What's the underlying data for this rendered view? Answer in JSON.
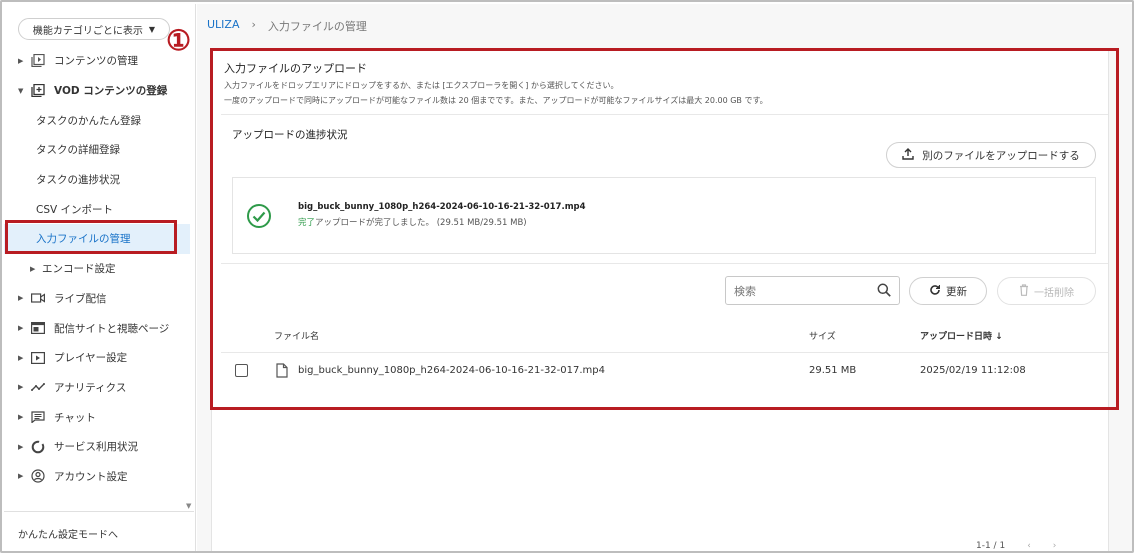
{
  "sidebar": {
    "category_select": "機能カテゴリごとに表示",
    "items": [
      {
        "label": "コンテンツの管理"
      },
      {
        "label": "VOD コンテンツの登録"
      },
      {
        "label": "タスクのかんたん登録"
      },
      {
        "label": "タスクの詳細登録"
      },
      {
        "label": "タスクの進捗状況"
      },
      {
        "label": "CSV インポート"
      },
      {
        "label": "入力ファイルの管理"
      },
      {
        "label": "エンコード設定"
      },
      {
        "label": "ライブ配信"
      },
      {
        "label": "配信サイトと視聴ページ"
      },
      {
        "label": "プレイヤー設定"
      },
      {
        "label": "アナリティクス"
      },
      {
        "label": "チャット"
      },
      {
        "label": "サービス利用状況"
      },
      {
        "label": "アカウント設定"
      }
    ],
    "simple_mode": "かんたん設定モードへ"
  },
  "breadcrumb": {
    "root": "ULIZA",
    "sep": "›",
    "current": "入力ファイルの管理"
  },
  "annotation_number": "①",
  "upload": {
    "title": "入力ファイルのアップロード",
    "desc1": "入力ファイルをドロップエリアにドロップをするか、または [エクスプローラを開く] から選択してください。",
    "desc2": "一度のアップロードで同時にアップロードが可能なファイル数は 20 個までです。また、アップロードが可能なファイルサイズは最大 20.00 GB です。",
    "progress_label": "アップロードの進捗状況",
    "upload_another": "別のファイルをアップロードする",
    "file_name": "big_buck_bunny_1080p_h264-2024-06-10-16-21-32-017.mp4",
    "status_done": "完了",
    "status_text": "アップロードが完了しました。 (29.51 MB/29.51 MB)"
  },
  "toolbar": {
    "search_placeholder": "検索",
    "refresh": "更新",
    "bulk_delete": "一括削除"
  },
  "table": {
    "headers": {
      "name": "ファイル名",
      "size": "サイズ",
      "date": "アップロード日時"
    },
    "rows": [
      {
        "name": "big_buck_bunny_1080p_h264-2024-06-10-16-21-32-017.mp4",
        "size": "29.51 MB",
        "date": "2025/02/19 11:12:08"
      }
    ]
  },
  "pager": {
    "range": "1-1 / 1",
    "prev": "‹",
    "next": "›"
  },
  "colors": {
    "accent": "#1a73c8",
    "highlight": "#b81c22",
    "success": "#2e9a49"
  }
}
